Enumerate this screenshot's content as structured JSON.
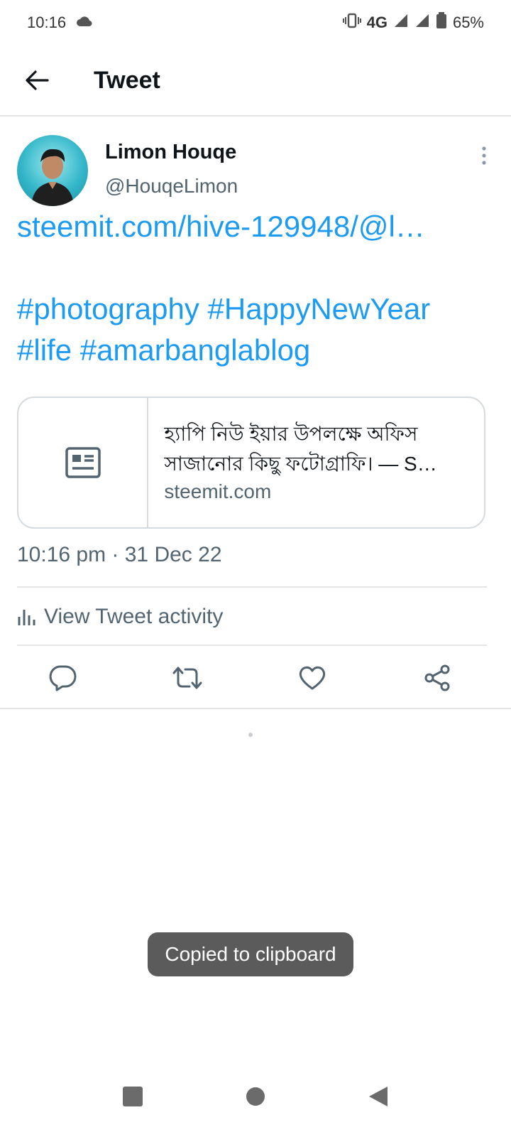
{
  "status_bar": {
    "time": "10:16",
    "network": "4G",
    "battery": "65%"
  },
  "app_bar": {
    "title": "Tweet"
  },
  "tweet": {
    "author_name": "Limon Houqe",
    "author_handle": "@HouqeLimon",
    "link_text": "steemit.com/hive-129948/@l…",
    "hashtags_line1": "#photography #HappyNewYear",
    "hashtags_line2": "#life #amarbanglablog",
    "card": {
      "title_line1": "হ্যাপি নিউ ইয়ার উপলক্ষে অফিস",
      "title_line2": "সাজানোর কিছু ফটোগ্রাফি। — S…",
      "domain": "steemit.com"
    },
    "timestamp": "10:16 pm · 31 Dec 22",
    "activity_label": "View Tweet activity"
  },
  "toast": "Copied to clipboard",
  "icons": {
    "back": "arrow-left-icon",
    "more": "more-vertical-icon",
    "reply": "reply-icon",
    "retweet": "retweet-icon",
    "like": "heart-icon",
    "share": "share-icon",
    "activity": "bar-chart-icon",
    "card": "article-icon"
  },
  "colors": {
    "link": "#1d9bf0",
    "secondary_text": "#536471",
    "toast_bg": "#5b5b5b"
  }
}
